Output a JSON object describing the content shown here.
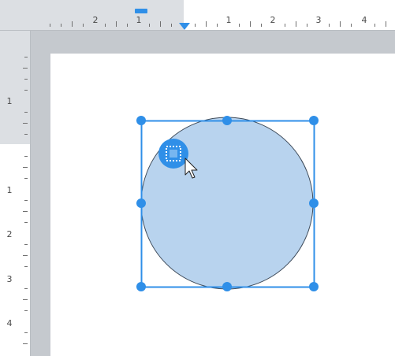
{
  "top_ruler": {
    "labels": [
      "2",
      "1",
      "1",
      "2",
      "3",
      "4"
    ]
  },
  "left_ruler": {
    "labels": [
      "1",
      "1",
      "2",
      "3",
      "4"
    ]
  },
  "colors": {
    "ruler_margin": "#dcdfe3",
    "ruler_work": "#ffffff",
    "canvas_gray": "#c5c9ce",
    "page": "#ffffff",
    "accent": "#2f8fe8",
    "circle_fill": "#b8d3ee",
    "circle_stroke": "#3e4b5a"
  },
  "icons": {
    "indent_marker": "ruler-indent-marker-icon",
    "tab_marker": "ruler-tab-marker-icon",
    "layout_options": "layout-options-icon",
    "cursor": "mouse-pointer-icon"
  },
  "shape": {
    "type": "circle",
    "selected": true
  }
}
